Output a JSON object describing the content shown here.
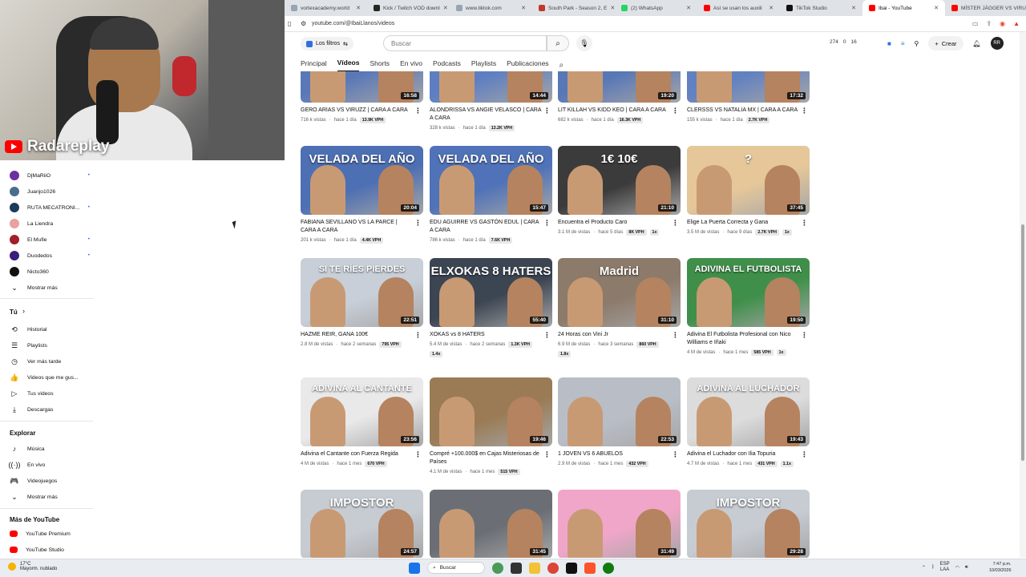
{
  "overlay": {
    "brand": "Radareplay"
  },
  "browser": {
    "tabs": [
      {
        "label": "vortexacademy.world",
        "color": "#9aa4b1"
      },
      {
        "label": "Kick / Twitch VOD downl",
        "color": "#1f2b1f"
      },
      {
        "label": "www.tiktok.com",
        "color": "#9aa4b1"
      },
      {
        "label": "South Park - Season 2, E",
        "color": "#c0392b"
      },
      {
        "label": "(2) WhatsApp",
        "color": "#25d366"
      },
      {
        "label": "Así se usan los auxili",
        "color": "#ff0000"
      },
      {
        "label": "TikTok Studio",
        "color": "#111111"
      },
      {
        "label": "Ibai - YouTube",
        "color": "#ff0000",
        "active": true
      },
      {
        "label": "MÍSTER JÄGGER VS VIRU",
        "color": "#ff0000"
      }
    ],
    "url": "youtube.com/@IbaiLlanos/videos"
  },
  "header": {
    "filters_label": "Los filtros",
    "search_placeholder": "Buscar",
    "stats": [
      "274",
      "0",
      "16"
    ],
    "create_label": "Crear",
    "avatar_text": "RR"
  },
  "channel_tabs": [
    {
      "label": "Principal"
    },
    {
      "label": "Vídeos",
      "active": true
    },
    {
      "label": "Shorts"
    },
    {
      "label": "En vivo"
    },
    {
      "label": "Podcasts"
    },
    {
      "label": "Playlists"
    },
    {
      "label": "Publicaciones"
    }
  ],
  "sidebar": {
    "subscriptions": [
      {
        "label": "DjMaRiiO",
        "color": "#6b2fa0",
        "dot": true
      },
      {
        "label": "Juanjo1026",
        "color": "#4a6d8c"
      },
      {
        "label": "RUTA MECATRONI...",
        "color": "#1b3b5a",
        "dot": true
      },
      {
        "label": "La Liendra",
        "color": "#e8a0a0"
      },
      {
        "label": "El Mufie",
        "color": "#a01f2a",
        "dot": true
      },
      {
        "label": "Duodedos",
        "color": "#3a1d7a",
        "dot": true
      },
      {
        "label": "Nicto360",
        "color": "#111111"
      }
    ],
    "show_more": "Mostrar más",
    "you_title": "Tú",
    "you_items": [
      {
        "label": "Historial",
        "icon": "history-icon",
        "glyph": "⟲"
      },
      {
        "label": "Playlists",
        "icon": "playlists-icon",
        "glyph": "☰"
      },
      {
        "label": "Ver más tarde",
        "icon": "watch-later-icon",
        "glyph": "◷"
      },
      {
        "label": "Videos que me gus...",
        "icon": "like-icon",
        "glyph": "👍"
      },
      {
        "label": "Tus videos",
        "icon": "your-videos-icon",
        "glyph": "▷"
      },
      {
        "label": "Descargas",
        "icon": "download-icon",
        "glyph": "⤓"
      }
    ],
    "explore_title": "Explorar",
    "explore_items": [
      {
        "label": "Música",
        "icon": "music-icon",
        "glyph": "♪"
      },
      {
        "label": "En vivo",
        "icon": "live-icon",
        "glyph": "((·))"
      },
      {
        "label": "Videojuegos",
        "icon": "gaming-icon",
        "glyph": "🎮"
      },
      {
        "label": "Mostrar más",
        "icon": "chevron-down-icon",
        "glyph": "⌄"
      }
    ],
    "more_title": "Más de YouTube",
    "more_items": [
      {
        "label": "YouTube Premium",
        "icon": "youtube-premium-icon",
        "color": "#ff0000"
      },
      {
        "label": "YouTube Studio",
        "icon": "youtube-studio-icon",
        "color": "#ff0000"
      }
    ]
  },
  "videos": [
    {
      "title": "GERO ARIAS VS VIRUZZ | CARA A CARA",
      "views": "716 k vistas",
      "age": "hace 1 día",
      "badges": [
        "13.9K VPH"
      ],
      "duration": "16:58",
      "bg": "#5a78b8",
      "overlay": ""
    },
    {
      "title": "ALONDRISSA VS ANGIE VELASCO | CARA A CARA",
      "views": "328 k vistas",
      "age": "hace 1 día",
      "badges": [
        "13.2K VPH"
      ],
      "duration": "14:44",
      "bg": "#5d7ec2",
      "overlay": ""
    },
    {
      "title": "LIT KILLAH VS KIDD KEO | CARA A CARA",
      "views": "682 k vistas",
      "age": "hace 1 día",
      "badges": [
        "16.3K VPH"
      ],
      "duration": "19:20",
      "bg": "#5877b7",
      "overlay": ""
    },
    {
      "title": "CLERSSS VS NATALIA MX | CARA A CARA",
      "views": "155 k vistas",
      "age": "hace 1 día",
      "badges": [
        "2.7K VPH"
      ],
      "duration": "17:32",
      "bg": "#6281c0",
      "overlay": ""
    },
    {
      "title": "FABIANA SEVILLANO VS LA PARCE | CARA A CARA",
      "views": "201 k vistas",
      "age": "hace 1 día",
      "badges": [
        "4.4K VPH"
      ],
      "duration": "20:04",
      "bg": "#4d6fb3",
      "overlay": "VELADA DEL AÑO"
    },
    {
      "title": "EDU AGUIRRE VS GASTÓN EDUL | CARA A CARA",
      "views": "786 k vistas",
      "age": "hace 1 día",
      "badges": [
        "7.6K VPH"
      ],
      "duration": "15:47",
      "bg": "#4f72b8",
      "overlay": "VELADA DEL AÑO"
    },
    {
      "title": "Encuentra el Producto Caro",
      "views": "3.1 M de vistas",
      "age": "hace 5 días",
      "badges": [
        "8K VPH",
        "1x"
      ],
      "duration": "21:10",
      "bg": "#3b3b3b",
      "overlay": "1€        10€"
    },
    {
      "title": "Elige La Puerta Correcta y Gana",
      "views": "3.5 M de vistas",
      "age": "hace 9 días",
      "badges": [
        "2.7K VPH",
        "1x"
      ],
      "duration": "37:45",
      "bg": "#e5c79a",
      "overlay": "?"
    },
    {
      "title": "HAZME REIR, GANA 100€",
      "views": "2.8 M de vistas",
      "age": "hace 2 semanas",
      "badges": [
        "795 VPH"
      ],
      "duration": "22:51",
      "bg": "#c8cfd8",
      "overlay": "SI TE RÍES PIERDES"
    },
    {
      "title": "XOKAS vs 8 HATERS",
      "views": "5.4 M de vistas",
      "age": "hace 2 semanas",
      "badges": [
        "1.3K VPH",
        "1.4x"
      ],
      "duration": "55:40",
      "bg": "#3c4552",
      "overlay": "ELXOKAS 8 HATERS"
    },
    {
      "title": "24 Horas con Vini Jr",
      "views": "6.9 M de vistas",
      "age": "hace 3 semanas",
      "badges": [
        "860 VPH",
        "1.8x"
      ],
      "duration": "31:10",
      "bg": "#8c7a6a",
      "overlay": "Madrid"
    },
    {
      "title": "Adivina El Futbolista Profesional con Nico Williams e Iñaki",
      "views": "4 M de vistas",
      "age": "hace 1 mes",
      "badges": [
        "585 VPH",
        "1x"
      ],
      "duration": "19:50",
      "bg": "#3f8f4a",
      "overlay": "ADIVINA EL FUTBOLISTA"
    },
    {
      "title": "Adivina el Cantante con Fuerza Regida",
      "views": "4 M de vistas",
      "age": "hace 1 mes",
      "badges": [
        "670 VPH"
      ],
      "duration": "23:56",
      "bg": "#e9e9e9",
      "overlay": "ADIVINA AL CANTANTE"
    },
    {
      "title": "Compré +100.000$ en Cajas Misteriosas de Países",
      "views": "4.1 M de vistas",
      "age": "hace 1 mes",
      "badges": [
        "515 VPH"
      ],
      "duration": "19:46",
      "bg": "#9a7b55",
      "overlay": ""
    },
    {
      "title": "1 JOVEN VS 6 ABUELOS",
      "views": "2.9 M de vistas",
      "age": "hace 1 mes",
      "badges": [
        "432 VPH"
      ],
      "duration": "22:53",
      "bg": "#b9bec6",
      "overlay": ""
    },
    {
      "title": "Adivina el Luchador con Ilia Topuria",
      "views": "4.7 M de vistas",
      "age": "hace 1 mes",
      "badges": [
        "431 VPH",
        "1.1x"
      ],
      "duration": "19:43",
      "bg": "#dcdcdc",
      "overlay": "ADIVINA AL LUCHADOR"
    },
    {
      "title": "",
      "views": "",
      "age": "",
      "badges": [],
      "duration": "24:57",
      "bg": "#c7ccd3",
      "overlay": "IMPOSTOR"
    },
    {
      "title": "",
      "views": "",
      "age": "",
      "badges": [],
      "duration": "31:45",
      "bg": "#6b6f75",
      "overlay": ""
    },
    {
      "title": "",
      "views": "",
      "age": "",
      "badges": [],
      "duration": "31:49",
      "bg": "#f0a6c8",
      "overlay": ""
    },
    {
      "title": "",
      "views": "",
      "age": "",
      "badges": [],
      "duration": "29:28",
      "bg": "#c7ccd3",
      "overlay": "IMPOSTOR"
    }
  ],
  "taskbar": {
    "weather_temp": "17°C",
    "weather_desc": "Mayorm. nublado",
    "search_label": "Buscar",
    "lang": "ESP",
    "lang2": "LAA",
    "time": "7:47 p.m.",
    "date": "10/03/2026"
  }
}
